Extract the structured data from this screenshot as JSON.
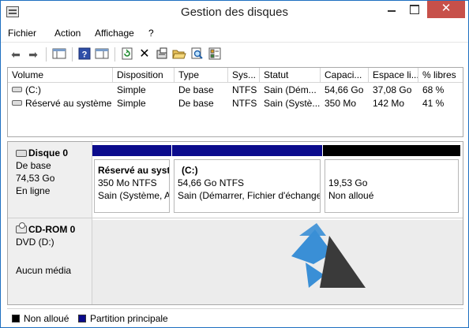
{
  "window": {
    "title": "Gestion des disques",
    "minimize_label": "",
    "maximize_label": "",
    "close_label": "✕"
  },
  "menu": [
    "Fichier",
    "Action",
    "Affichage",
    "?"
  ],
  "toolbar": {
    "icons": [
      "back-arrow-icon",
      "forward-arrow-icon",
      "console-tree-icon",
      "help-icon",
      "properties-pane-icon",
      "refresh-icon",
      "delete-icon",
      "properties-icon",
      "open-folder-icon",
      "search-icon",
      "checklist-icon"
    ],
    "glyphs": {
      "back": "⬅",
      "forward": "➡",
      "help": "?",
      "refresh": "↻",
      "delete": "✕"
    }
  },
  "volume_list": {
    "columns": [
      "Volume",
      "Disposition",
      "Type",
      "Sys...",
      "Statut",
      "Capaci...",
      "Espace li...",
      "% libres"
    ],
    "rows": [
      [
        "(C:)",
        "Simple",
        "De base",
        "NTFS",
        "Sain (Dém...",
        "54,66 Go",
        "37,08 Go",
        "68 %"
      ],
      [
        "Réservé au système",
        "Simple",
        "De base",
        "NTFS",
        "Sain (Systè...",
        "350 Mo",
        "142 Mo",
        "41 %"
      ]
    ]
  },
  "disks": [
    {
      "name": "Disque 0",
      "lines": [
        "De base",
        "74,53 Go",
        "En ligne"
      ],
      "partitions": [
        {
          "name": "Réservé au syst",
          "size": "350 Mo NTFS",
          "status": "Sain (Système, A",
          "bar": "blue"
        },
        {
          "name": "(C:)",
          "size": "54,66 Go NTFS",
          "status": "Sain (Démarrer, Fichier d'échange",
          "bar": "blue"
        },
        {
          "name": "",
          "size": "19,53 Go",
          "status": "Non alloué",
          "bar": "black"
        }
      ]
    },
    {
      "name": "CD-ROM 0",
      "lines": [
        "DVD (D:)",
        "",
        "Aucun média"
      ]
    }
  ],
  "legend": [
    {
      "label": "Non alloué",
      "color": "#000000"
    },
    {
      "label": "Partition principale",
      "color": "#0b0b8c"
    }
  ],
  "colors": {
    "primary_partition": "#0b0b8c",
    "unallocated": "#000000",
    "close_button": "#c7504a",
    "logo_blue": "#3a8fd6",
    "logo_dark": "#3a3a3a"
  }
}
